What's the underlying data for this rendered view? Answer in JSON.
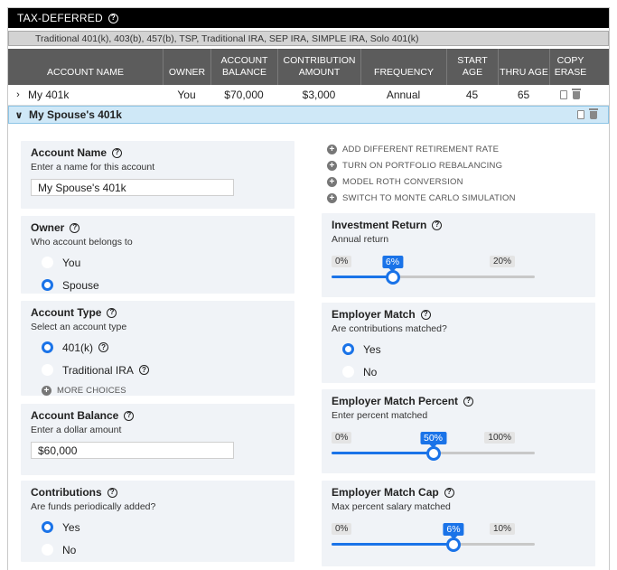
{
  "section": {
    "title": "TAX-DEFERRED",
    "subtitle": "Traditional 401(k), 403(b), 457(b), TSP, Traditional IRA, SEP IRA, SIMPLE IRA, Solo 401(k)"
  },
  "columns": {
    "name": "ACCOUNT NAME",
    "owner": "OWNER",
    "balance_l1": "ACCOUNT",
    "balance_l2": "BALANCE",
    "contrib_l1": "CONTRIBUTION",
    "contrib_l2": "AMOUNT",
    "frequency": "FREQUENCY",
    "start_age": "START AGE",
    "thru_age": "THRU AGE",
    "actions_l1": "COPY",
    "actions_l2": "ERASE"
  },
  "accounts": [
    {
      "name": "My 401k",
      "owner": "You",
      "balance": "$70,000",
      "contribution": "$3,000",
      "frequency": "Annual",
      "start_age": "45",
      "thru_age": "65"
    },
    {
      "name": "My Spouse's 401k"
    }
  ],
  "form": {
    "account_name": {
      "title": "Account Name",
      "sub": "Enter a name for this account",
      "value": "My Spouse's 401k"
    },
    "owner": {
      "title": "Owner",
      "sub": "Who account belongs to",
      "options": [
        "You",
        "Spouse"
      ],
      "selected": "Spouse"
    },
    "account_type": {
      "title": "Account Type",
      "sub": "Select an account type",
      "options": [
        "401(k)",
        "Traditional IRA"
      ],
      "selected": "401(k)",
      "more": "MORE CHOICES"
    },
    "account_balance": {
      "title": "Account Balance",
      "sub": "Enter a dollar amount",
      "value": "$60,000"
    },
    "contributions": {
      "title": "Contributions",
      "sub": "Are funds periodically added?",
      "options": [
        "Yes",
        "No"
      ],
      "selected": "Yes"
    }
  },
  "options_links": [
    "ADD DIFFERENT RETIREMENT RATE",
    "TURN ON PORTFOLIO REBALANCING",
    "MODEL ROTH CONVERSION",
    "SWITCH TO MONTE CARLO SIMULATION"
  ],
  "investment_return": {
    "title": "Investment Return",
    "sub": "Annual return",
    "min": "0%",
    "max": "20%",
    "value_label": "6%",
    "value": 6,
    "range": [
      0,
      20
    ]
  },
  "employer_match": {
    "title": "Employer Match",
    "sub": "Are contributions matched?",
    "options": [
      "Yes",
      "No"
    ],
    "selected": "Yes"
  },
  "match_percent": {
    "title": "Employer Match Percent",
    "sub": "Enter percent matched",
    "min": "0%",
    "max": "100%",
    "value_label": "50%",
    "value": 50,
    "range": [
      0,
      100
    ]
  },
  "match_cap": {
    "title": "Employer Match Cap",
    "sub": "Max percent salary matched",
    "min": "0%",
    "max": "10%",
    "value_label": "6%",
    "value": 6,
    "range": [
      0,
      10
    ]
  },
  "colors": {
    "accent": "#1a73e8",
    "header_bg": "#5c5c5c",
    "title_bg": "#000000",
    "selected_row": "#cfe8f7",
    "card_bg": "#f0f3f7"
  }
}
